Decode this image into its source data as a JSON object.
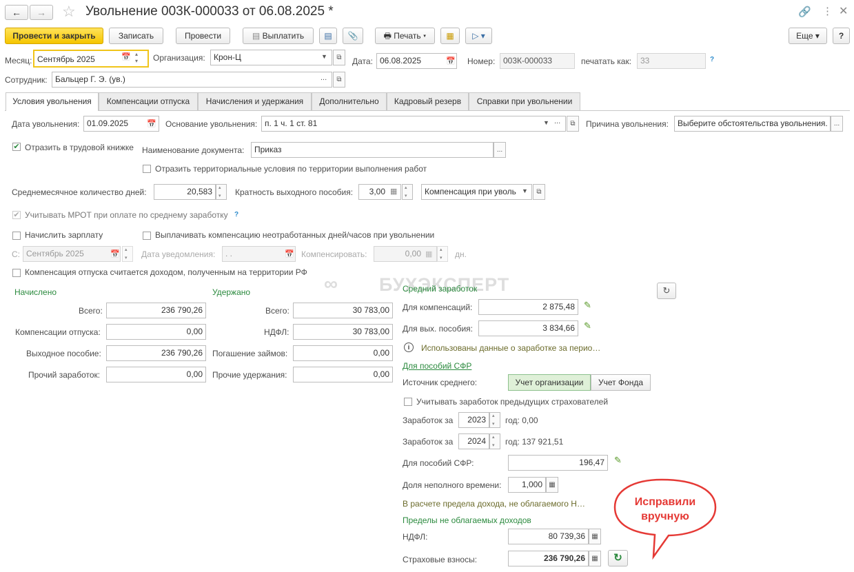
{
  "header": {
    "title": "Увольнение 003К-000033 от 06.08.2025 *"
  },
  "toolbar": {
    "post_close": "Провести и закрыть",
    "save": "Записать",
    "post": "Провести",
    "pay": "Выплатить",
    "print": "Печать",
    "more": "Еще",
    "help": "?"
  },
  "top": {
    "month_label": "Месяц:",
    "month_value": "Сентябрь 2025",
    "org_label": "Организация:",
    "org_value": "Крон-Ц",
    "date_label": "Дата:",
    "date_value": "06.08.2025",
    "number_label": "Номер:",
    "number_value": "003К-000033",
    "print_as_label": "печатать как:",
    "print_as_value": "33",
    "help": "?",
    "employee_label": "Сотрудник:",
    "employee_value": "Бальцер Г. Э. (ув.)"
  },
  "tabs": [
    "Условия увольнения",
    "Компенсации отпуска",
    "Начисления и удержания",
    "Дополнительно",
    "Кадровый резерв",
    "Справки при увольнении"
  ],
  "conditions": {
    "dismissal_date_label": "Дата увольнения:",
    "dismissal_date_value": "01.09.2025",
    "basis_label": "Основание увольнения:",
    "basis_value": "п. 1 ч. 1 ст. 81",
    "reason_label": "Причина увольнения:",
    "reason_value": "Выберите обстоятельства увольнения.",
    "workbook_label": "Отразить в трудовой книжке",
    "doc_name_label": "Наименование документа:",
    "doc_name_value": "Приказ",
    "territorial_label": "Отразить территориальные условия по территории выполнения работ",
    "avg_days_label": "Среднемесячное количество дней:",
    "avg_days_value": "20,583",
    "multiplicity_label": "Кратность выходного пособия:",
    "multiplicity_value": "3,00",
    "comp_select": "Компенсация при уволь",
    "mrot_label": "Учитывать МРОТ при оплате по среднему заработку",
    "mrot_help": "?",
    "accrue_salary_label": "Начислить зарплату",
    "pay_comp_label": "Выплачивать компенсацию неотработанных дней/часов при увольнении",
    "from_label": "С:",
    "from_value": "Сентябрь 2025",
    "notice_date_label": "Дата уведомления:",
    "notice_date_value": ". .",
    "compensate_label": "Компенсировать:",
    "compensate_value": "0,00",
    "days_unit": "дн.",
    "income_rf_label": "Компенсация отпуска считается доходом, полученным на территории РФ"
  },
  "watermark": "БУХЭКСПЕРТ",
  "accrued": {
    "title": "Начислено",
    "rows": [
      {
        "label": "Всего:",
        "value": "236 790,26"
      },
      {
        "label": "Компенсации отпуска:",
        "value": "0,00"
      },
      {
        "label": "Выходное пособие:",
        "value": "236 790,26"
      },
      {
        "label": "Прочий заработок:",
        "value": "0,00"
      }
    ]
  },
  "withheld": {
    "title": "Удержано",
    "rows": [
      {
        "label": "Всего:",
        "value": "30 783,00"
      },
      {
        "label": "НДФЛ:",
        "value": "30 783,00"
      },
      {
        "label": "Погашение займов:",
        "value": "0,00"
      },
      {
        "label": "Прочие удержания:",
        "value": "0,00"
      }
    ]
  },
  "average": {
    "title": "Средний заработок",
    "comp_label": "Для компенсаций:",
    "comp_value": "2 875,48",
    "sev_label": "Для вых. пособия:",
    "sev_value": "3 834,66",
    "info": "Использованы данные о заработке за перио…",
    "sfr_link": "Для пособий СФР",
    "source_label": "Источник среднего:",
    "source_org": "Учет организации",
    "source_fund": "Учет Фонда",
    "prev_insurers_label": "Учитывать заработок предыдущих страхователей",
    "earn_label": "Заработок за",
    "year1": "2023",
    "year1_text": "год: 0,00",
    "year2": "2024",
    "year2_text": "год: 137 921,51",
    "sfr_label": "Для пособий СФР:",
    "sfr_value": "196,47",
    "parttime_label": "Доля неполного времени:",
    "parttime_value": "1,000",
    "calc_note": "В расчете предела дохода, не облагаемого Н…",
    "limits_title": "Пределы не облагаемых доходов",
    "ndfl_label": "НДФЛ:",
    "ndfl_value": "80 739,36",
    "ins_label": "Страховые взносы:",
    "ins_value": "236 790,26"
  },
  "callout": {
    "text": "Исправили вручную"
  },
  "colors": {
    "accent_yellow": "#f5c500",
    "green": "#2b8a3e",
    "callout_red": "#e53935"
  }
}
